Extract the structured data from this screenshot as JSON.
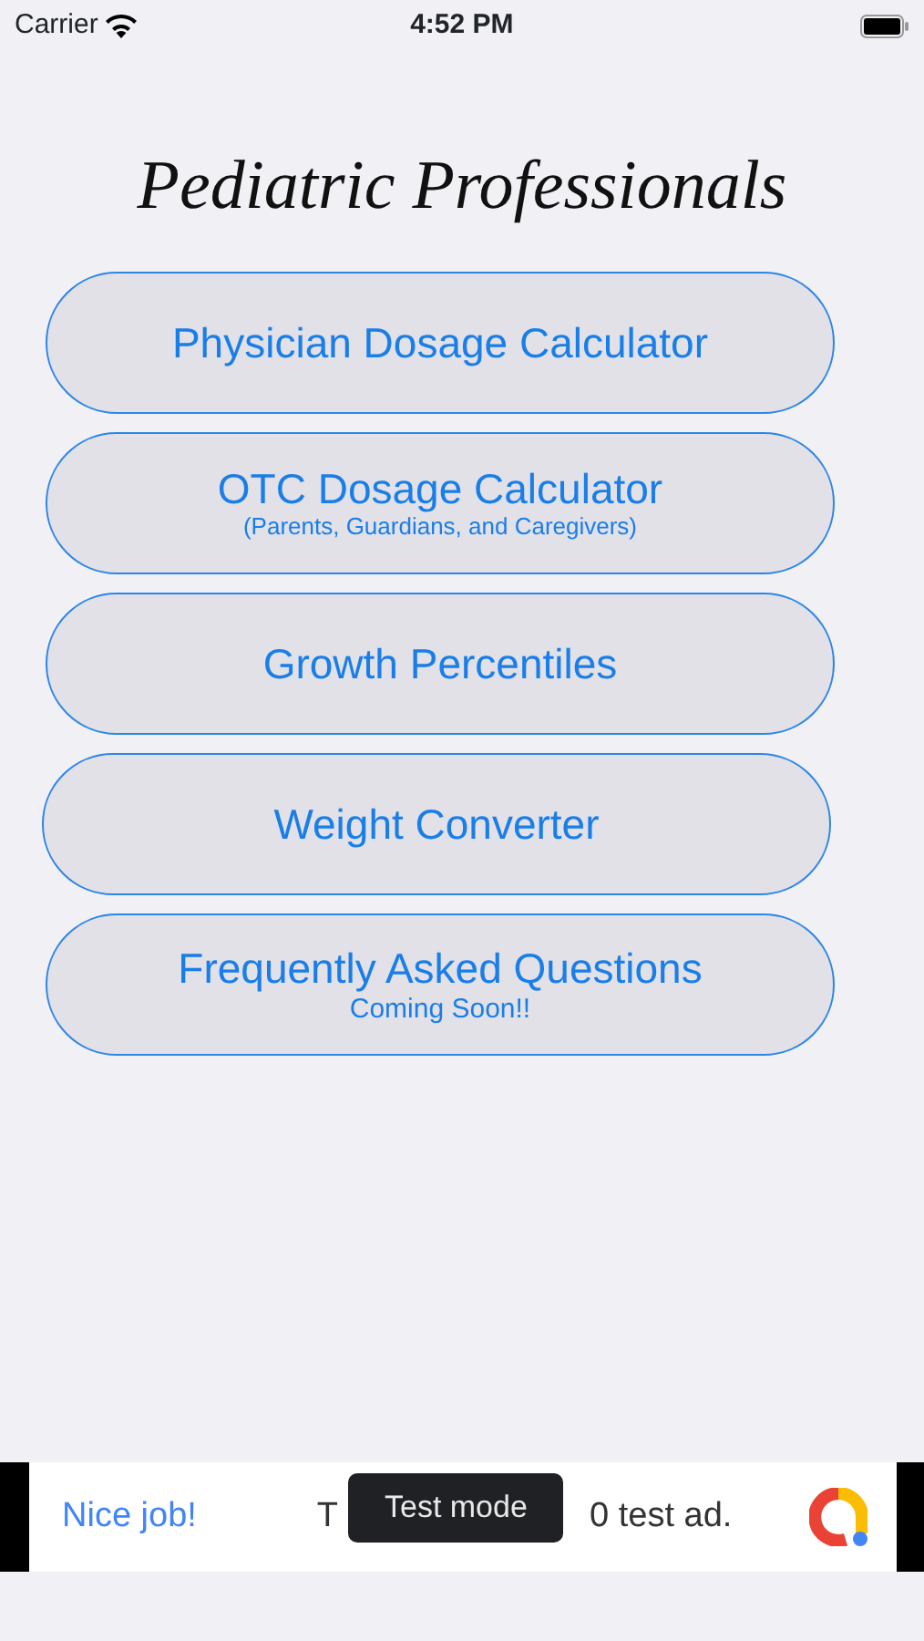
{
  "status_bar": {
    "carrier": "Carrier",
    "time": "4:52 PM"
  },
  "title": "Pediatric Professionals",
  "menu": [
    {
      "label": "Physician Dosage Calculator"
    },
    {
      "label": "OTC Dosage Calculator",
      "subtitle": "(Parents, Guardians, and Caregivers)"
    },
    {
      "label": "Growth Percentiles"
    },
    {
      "label": "Weight Converter"
    },
    {
      "label": "Frequently Asked Questions",
      "subtitle": "Coming Soon!!"
    }
  ],
  "ad_banner": {
    "headline": "Nice job!",
    "text_start": "T",
    "text_end": "0 test ad.",
    "tooltip": "Test mode"
  }
}
